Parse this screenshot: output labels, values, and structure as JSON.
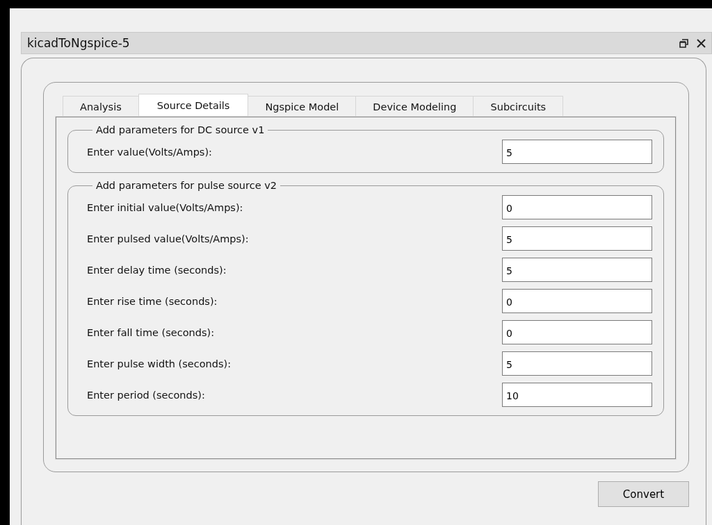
{
  "window": {
    "title": "kicadToNgspice-5"
  },
  "tabs": [
    {
      "label": "Analysis",
      "selected": false
    },
    {
      "label": "Source Details",
      "selected": true
    },
    {
      "label": "Ngspice Model",
      "selected": false
    },
    {
      "label": "Device Modeling",
      "selected": false
    },
    {
      "label": "Subcircuits",
      "selected": false
    }
  ],
  "groups": [
    {
      "title": "Add parameters for DC source v1",
      "fields": [
        {
          "label": "Enter value(Volts/Amps):",
          "value": "5"
        }
      ]
    },
    {
      "title": "Add parameters for pulse source v2",
      "fields": [
        {
          "label": "Enter initial value(Volts/Amps):",
          "value": "0"
        },
        {
          "label": "Enter pulsed value(Volts/Amps):",
          "value": "5"
        },
        {
          "label": "Enter delay time (seconds):",
          "value": "5"
        },
        {
          "label": "Enter rise time (seconds):",
          "value": "0"
        },
        {
          "label": "Enter fall time (seconds):",
          "value": "0"
        },
        {
          "label": "Enter pulse width (seconds):",
          "value": "5"
        },
        {
          "label": "Enter period (seconds):",
          "value": "10"
        }
      ]
    }
  ],
  "buttons": [
    "Convert"
  ]
}
